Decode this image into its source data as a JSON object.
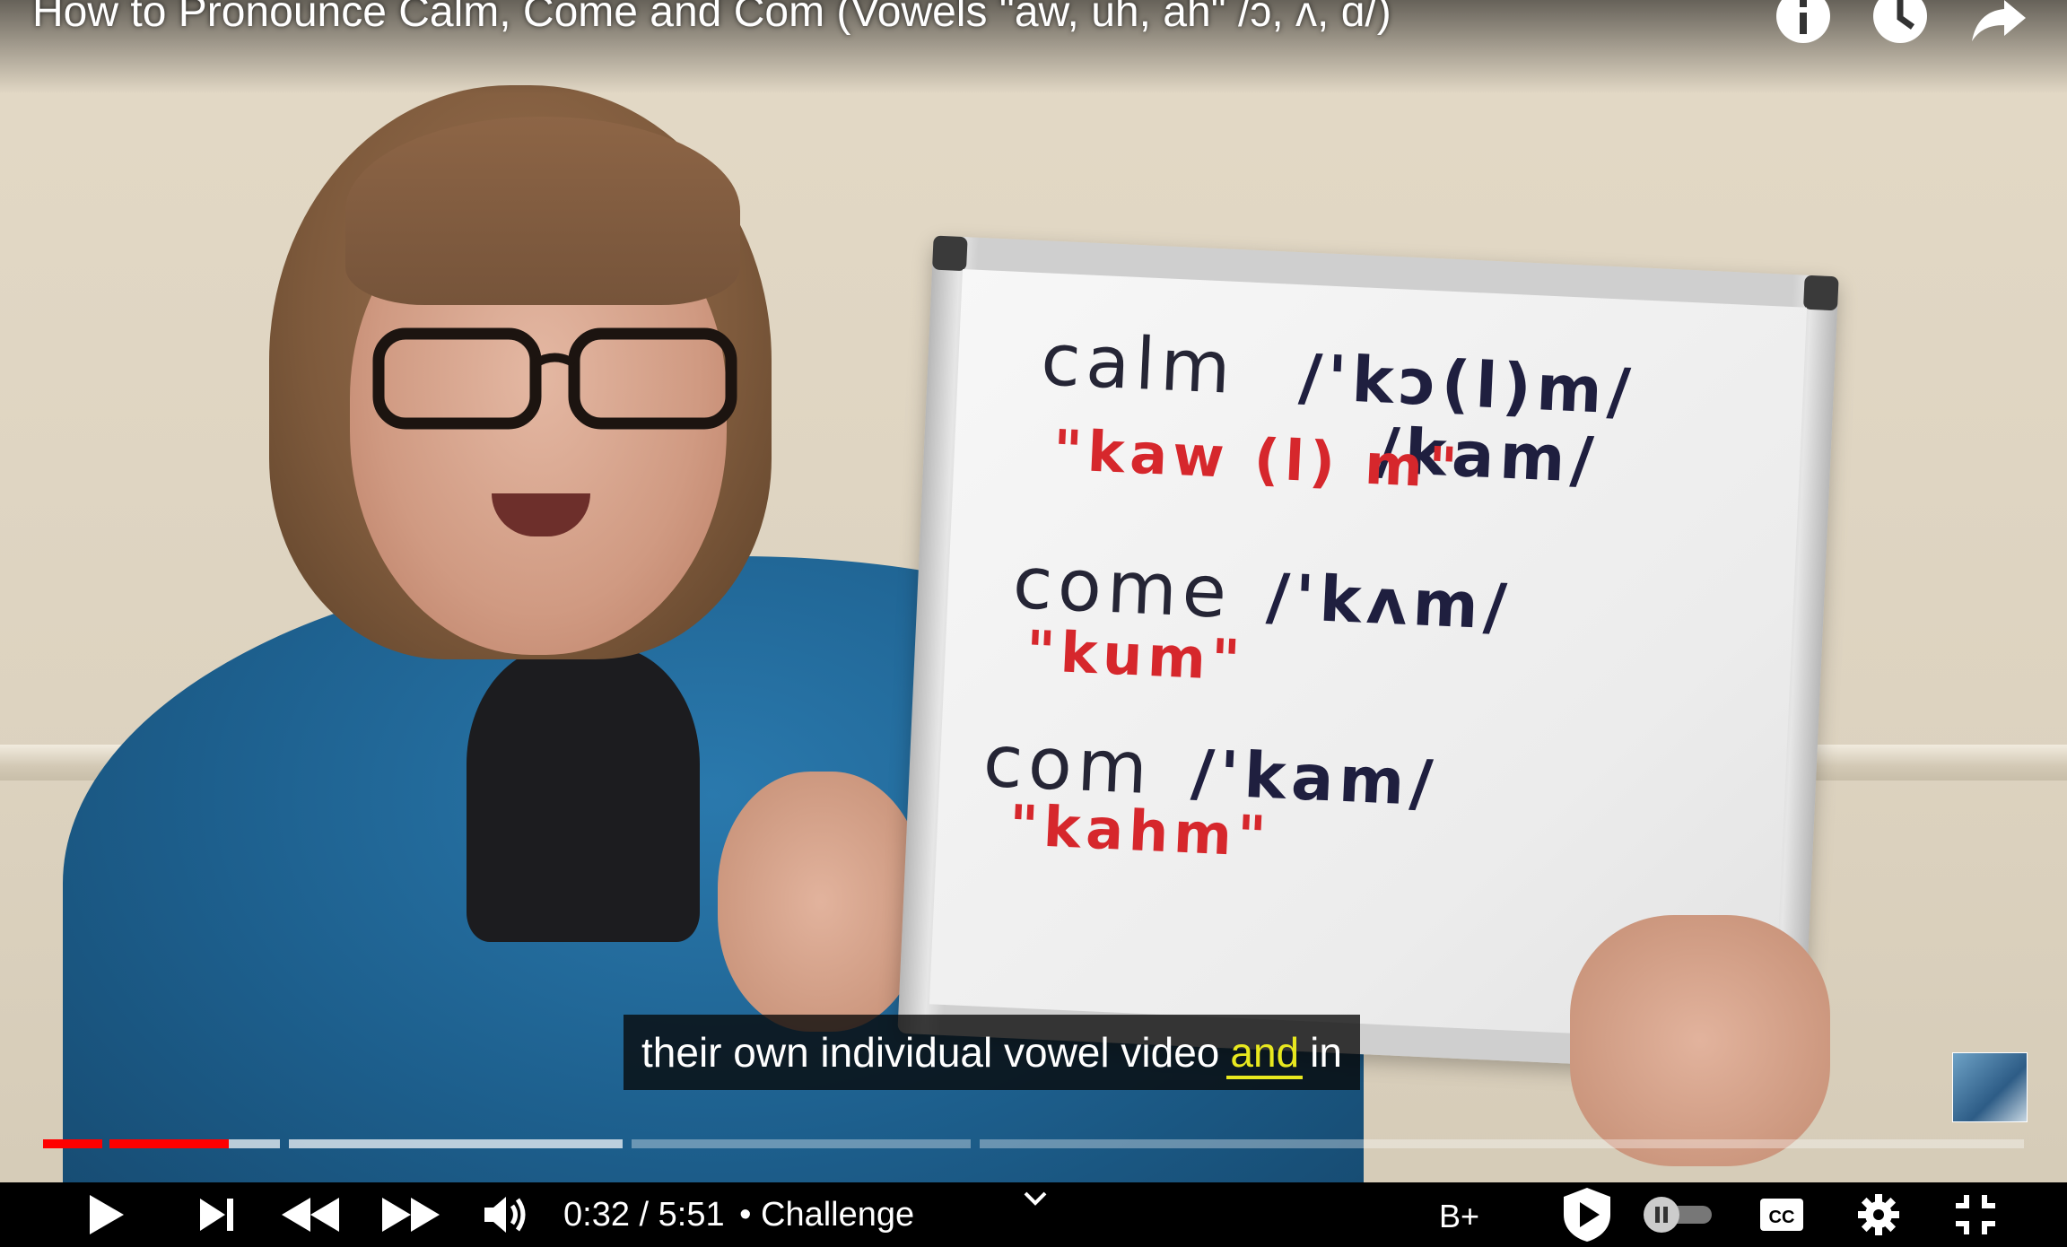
{
  "video": {
    "title": "How to Pronounce Calm, Come and Com (Vowels \"aw, uh, ah\" /ɔ, ʌ, ɑ/)",
    "caption": {
      "before": "their own individual vowel video",
      "highlight": "and",
      "after": "in"
    }
  },
  "whiteboard": {
    "rows": [
      {
        "word": "calm",
        "ipa": "/'kɔ(l)m/",
        "ipa_alt": "/kam/",
        "respelling": "\"kaw (l) m\""
      },
      {
        "word": "come",
        "ipa": "/'kʌm/",
        "respelling": "\"kum\""
      },
      {
        "word": "com",
        "ipa": "/'kam/",
        "respelling": "\"kahm\""
      }
    ]
  },
  "controls": {
    "time": "0:32 / 5:51",
    "chapter": "• Challenge",
    "quality_badge": "B+",
    "progress_played": 0.063,
    "progress_loaded": 0.199
  },
  "colors": {
    "progress_red": "#ff0000",
    "caption_highlight": "#e8e81f",
    "board_red": "#d6272c"
  },
  "icons": {
    "top": [
      "info-icon",
      "watch-later-clock-icon",
      "share-arrow-icon"
    ],
    "bottom_left": [
      "play-icon",
      "next-icon",
      "rewind-icon",
      "fast-forward-icon",
      "volume-icon",
      "chevron-down-icon"
    ],
    "bottom_right": [
      "shield-play-icon",
      "autoplay-toggle-icon",
      "cc-icon",
      "gear-icon",
      "exit-fullscreen-icon"
    ]
  }
}
